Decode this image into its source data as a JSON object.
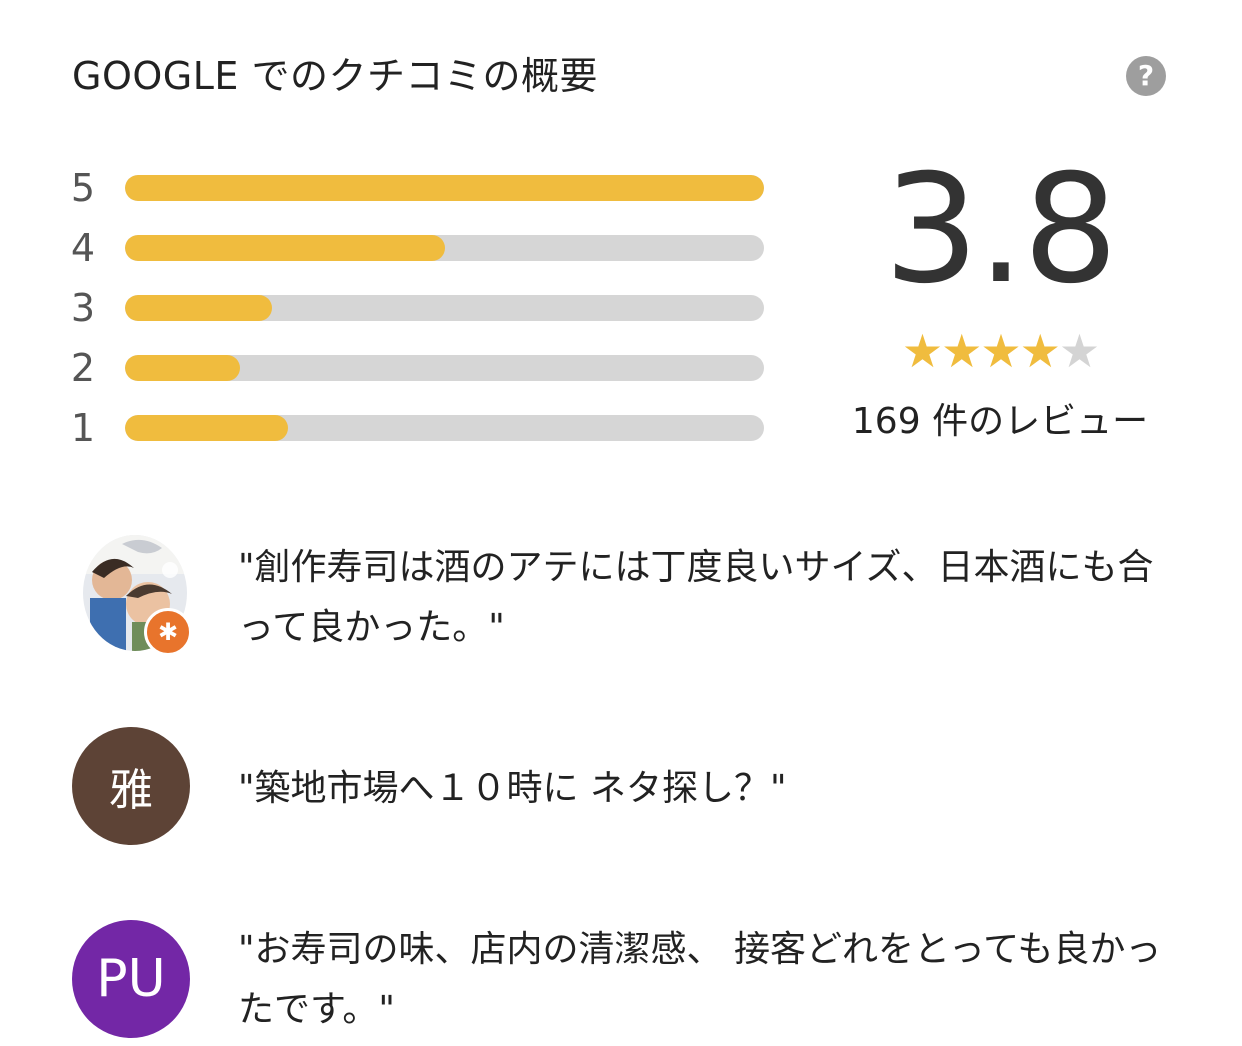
{
  "header": {
    "title": "GOOGLE でのクチコミの概要",
    "help_icon": "question-icon",
    "help_glyph": "?"
  },
  "histogram": [
    {
      "label": "5",
      "fraction": 1.0
    },
    {
      "label": "4",
      "fraction": 0.5
    },
    {
      "label": "3",
      "fraction": 0.23
    },
    {
      "label": "2",
      "fraction": 0.18
    },
    {
      "label": "1",
      "fraction": 0.255
    }
  ],
  "summary": {
    "score": "3.8",
    "stars_filled": 4,
    "stars_total": 5,
    "review_count": "169 件のレビュー"
  },
  "reviews": [
    {
      "avatar_type": "photo",
      "avatar_initials": "",
      "avatar_color": "#dfe3e8",
      "badge_icon": "local-guide-star-icon",
      "text": "\"創作寿司は酒のアテには丁度良いサイズ、日本酒にも合って良かった。\""
    },
    {
      "avatar_type": "initials",
      "avatar_initials": "雅",
      "avatar_color": "#5d4336",
      "text": "\"築地市場へ１０時に ネタ探し？\""
    },
    {
      "avatar_type": "initials",
      "avatar_initials": "PU",
      "avatar_color": "#7327a6",
      "text": "\"お寿司の味、店内の清潔感、 接客どれをとっても良かったです。\""
    }
  ],
  "colors": {
    "bar_fill": "#f0bc3e",
    "bar_track": "#d6d6d6",
    "star_empty": "#d4d4d4"
  }
}
